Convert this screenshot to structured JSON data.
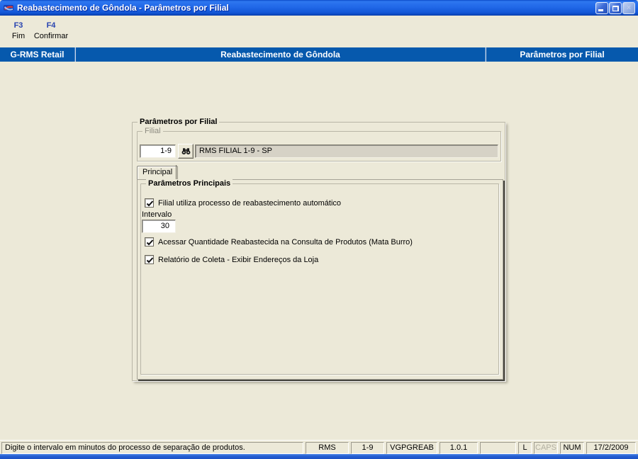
{
  "window": {
    "title": "Reabastecimento de Gôndola - Parâmetros por Filial"
  },
  "toolbar": {
    "items": [
      {
        "key": "F3",
        "label": "Fim"
      },
      {
        "key": "F4",
        "label": "Confirmar"
      }
    ]
  },
  "header": {
    "left": "G-RMS Retail",
    "center": "Reabastecimento de Gôndola",
    "right": "Parâmetros por Filial"
  },
  "form": {
    "group_title": "Parâmetros por Filial",
    "filial": {
      "group_title": "Filial",
      "code": "1-9",
      "description": "RMS FILIAL 1-9 - SP"
    },
    "tab": {
      "label": "Principal",
      "selected": true
    },
    "principal": {
      "group_title": "Parâmetros Principais",
      "checkbox_auto": {
        "label": "Filial utiliza processo de reabastecimento automático",
        "checked": true
      },
      "intervalo": {
        "label": "Intervalo",
        "value": "30"
      },
      "checkbox_mata_burro": {
        "label": "Acessar Quantidade Reabastecida na Consulta de Produtos (Mata Burro)",
        "checked": true
      },
      "checkbox_relatorio": {
        "label": "Relatório de Coleta - Exibir Endereços da Loja",
        "checked": true
      }
    }
  },
  "statusbar": {
    "message": "Digite o intervalo em minutos do processo de separação de produtos.",
    "cells": {
      "user": "RMS",
      "filial": "1-9",
      "program": "VGPGREAB",
      "version": "1.0.1",
      "empty": "",
      "l_indicator": "L",
      "caps": "CAPS",
      "num": "NUM",
      "date": "17/2/2009"
    }
  },
  "icons": {
    "app_icon": "rms-logo",
    "minimize_icon": "minimize",
    "restore_icon": "restore",
    "close_icon": "close-x",
    "search_icon": "binoculars",
    "check_icon": "checkmark"
  },
  "colors": {
    "titlebar_blue": "#1C5FD8",
    "header_band_blue": "#0659AD",
    "window_bg": "#ECE9D8",
    "readonly_field_bg": "#D6D2C6",
    "toolbar_key_blue": "#2743B0",
    "disabled_text": "#B2AFA1"
  }
}
